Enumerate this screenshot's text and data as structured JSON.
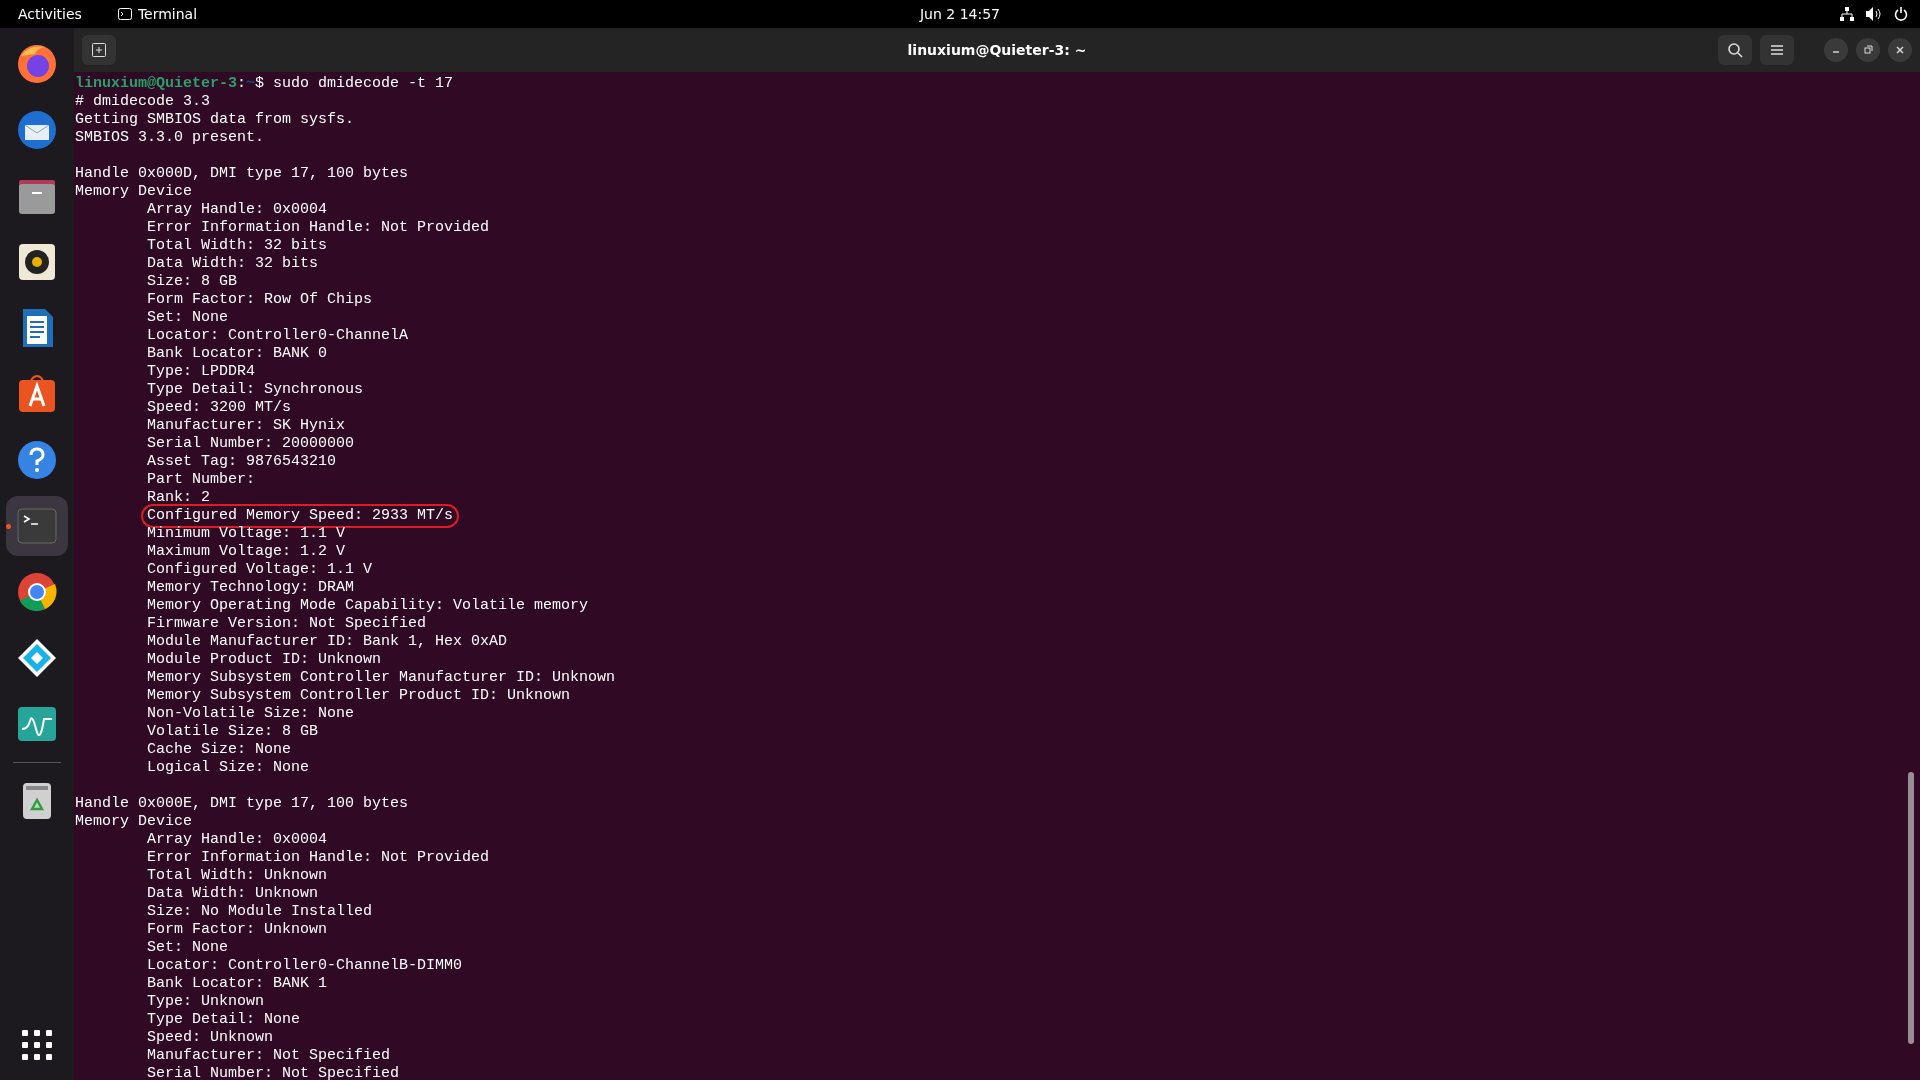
{
  "top_bar": {
    "activities": "Activities",
    "app_name": "Terminal",
    "clock": "Jun 2  14:57"
  },
  "dock": [
    {
      "kind": "firefox",
      "selected": false,
      "running": false
    },
    {
      "kind": "mail",
      "selected": false,
      "running": false
    },
    {
      "kind": "files",
      "selected": false,
      "running": false
    },
    {
      "kind": "music",
      "selected": false,
      "running": false
    },
    {
      "kind": "writer",
      "selected": false,
      "running": false
    },
    {
      "kind": "store",
      "selected": false,
      "running": false
    },
    {
      "kind": "help",
      "selected": false,
      "running": false
    },
    {
      "kind": "terminal",
      "selected": true,
      "running": true
    },
    {
      "kind": "chrome",
      "selected": false,
      "running": false
    },
    {
      "kind": "kodi",
      "selected": false,
      "running": false
    },
    {
      "kind": "monitor",
      "selected": false,
      "running": false
    },
    {
      "kind": "trash",
      "selected": false,
      "running": false
    }
  ],
  "window": {
    "title": "linuxium@Quieter-3: ~"
  },
  "terminal": {
    "prompt": {
      "user_host": "linuxium@Quieter-3",
      "separator": ":",
      "path": "~",
      "symbol": "$",
      "command": "sudo dmidecode -t 17"
    },
    "intro": [
      "# dmidecode 3.3",
      "Getting SMBIOS data from sysfs.",
      "SMBIOS 3.3.0 present."
    ],
    "records": [
      {
        "handle": "Handle 0x000D, DMI type 17, 100 bytes",
        "name": "Memory Device",
        "fields": [
          {
            "text": "Array Handle: 0x0004",
            "circled": false
          },
          {
            "text": "Error Information Handle: Not Provided",
            "circled": false
          },
          {
            "text": "Total Width: 32 bits",
            "circled": false
          },
          {
            "text": "Data Width: 32 bits",
            "circled": false
          },
          {
            "text": "Size: 8 GB",
            "circled": false
          },
          {
            "text": "Form Factor: Row Of Chips",
            "circled": false
          },
          {
            "text": "Set: None",
            "circled": false
          },
          {
            "text": "Locator: Controller0-ChannelA",
            "circled": false
          },
          {
            "text": "Bank Locator: BANK 0",
            "circled": false
          },
          {
            "text": "Type: LPDDR4",
            "circled": false
          },
          {
            "text": "Type Detail: Synchronous",
            "circled": false
          },
          {
            "text": "Speed: 3200 MT/s",
            "circled": false
          },
          {
            "text": "Manufacturer: SK Hynix",
            "circled": false
          },
          {
            "text": "Serial Number: 20000000",
            "circled": false
          },
          {
            "text": "Asset Tag: 9876543210",
            "circled": false
          },
          {
            "text": "Part Number:",
            "circled": false
          },
          {
            "text": "Rank: 2",
            "circled": false
          },
          {
            "text": "Configured Memory Speed: 2933 MT/s",
            "circled": true
          },
          {
            "text": "Minimum Voltage: 1.1 V",
            "circled": false
          },
          {
            "text": "Maximum Voltage: 1.2 V",
            "circled": false
          },
          {
            "text": "Configured Voltage: 1.1 V",
            "circled": false
          },
          {
            "text": "Memory Technology: DRAM",
            "circled": false
          },
          {
            "text": "Memory Operating Mode Capability: Volatile memory",
            "circled": false
          },
          {
            "text": "Firmware Version: Not Specified",
            "circled": false
          },
          {
            "text": "Module Manufacturer ID: Bank 1, Hex 0xAD",
            "circled": false
          },
          {
            "text": "Module Product ID: Unknown",
            "circled": false
          },
          {
            "text": "Memory Subsystem Controller Manufacturer ID: Unknown",
            "circled": false
          },
          {
            "text": "Memory Subsystem Controller Product ID: Unknown",
            "circled": false
          },
          {
            "text": "Non-Volatile Size: None",
            "circled": false
          },
          {
            "text": "Volatile Size: 8 GB",
            "circled": false
          },
          {
            "text": "Cache Size: None",
            "circled": false
          },
          {
            "text": "Logical Size: None",
            "circled": false
          }
        ]
      },
      {
        "handle": "Handle 0x000E, DMI type 17, 100 bytes",
        "name": "Memory Device",
        "fields": [
          {
            "text": "Array Handle: 0x0004",
            "circled": false
          },
          {
            "text": "Error Information Handle: Not Provided",
            "circled": false
          },
          {
            "text": "Total Width: Unknown",
            "circled": false
          },
          {
            "text": "Data Width: Unknown",
            "circled": false
          },
          {
            "text": "Size: No Module Installed",
            "circled": false
          },
          {
            "text": "Form Factor: Unknown",
            "circled": false
          },
          {
            "text": "Set: None",
            "circled": false
          },
          {
            "text": "Locator: Controller0-ChannelB-DIMM0",
            "circled": false
          },
          {
            "text": "Bank Locator: BANK 1",
            "circled": false
          },
          {
            "text": "Type: Unknown",
            "circled": false
          },
          {
            "text": "Type Detail: None",
            "circled": false
          },
          {
            "text": "Speed: Unknown",
            "circled": false
          },
          {
            "text": "Manufacturer: Not Specified",
            "circled": false
          },
          {
            "text": "Serial Number: Not Specified",
            "circled": false
          }
        ]
      }
    ]
  }
}
